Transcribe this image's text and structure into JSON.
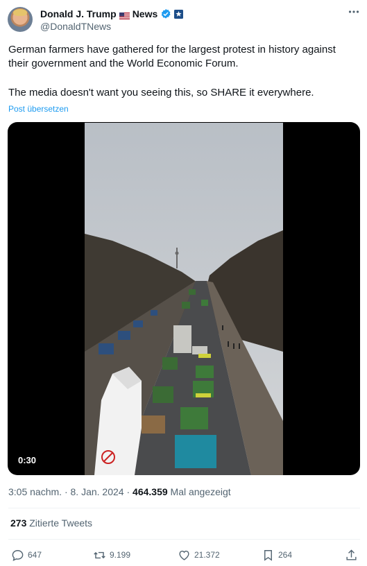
{
  "author": {
    "display_name": "Donald J. Trump",
    "name_suffix": "News",
    "handle": "@DonaldTNews",
    "verified_color": "#1d9bf0"
  },
  "tweet": {
    "text_line1": "German farmers have gathered for the largest protest in history against their government and the World Economic Forum.",
    "text_line2": "The media doesn't want you seeing this, so SHARE it everywhere.",
    "translate_label": "Post übersetzen"
  },
  "media": {
    "duration": "0:30"
  },
  "meta": {
    "time": "3:05 nachm.",
    "separator": "·",
    "date": "8. Jan. 2024",
    "views_count": "464.359",
    "views_label": "Mal angezeigt"
  },
  "quotes": {
    "count": "273",
    "label": "Zitierte Tweets"
  },
  "actions": {
    "replies": "647",
    "retweets": "9.199",
    "likes": "21.372",
    "bookmarks": "264"
  },
  "icons": [
    "more-icon",
    "verified-icon",
    "flag-icon",
    "gov-icon",
    "reply-icon",
    "retweet-icon",
    "like-icon",
    "bookmark-icon",
    "share-icon"
  ]
}
